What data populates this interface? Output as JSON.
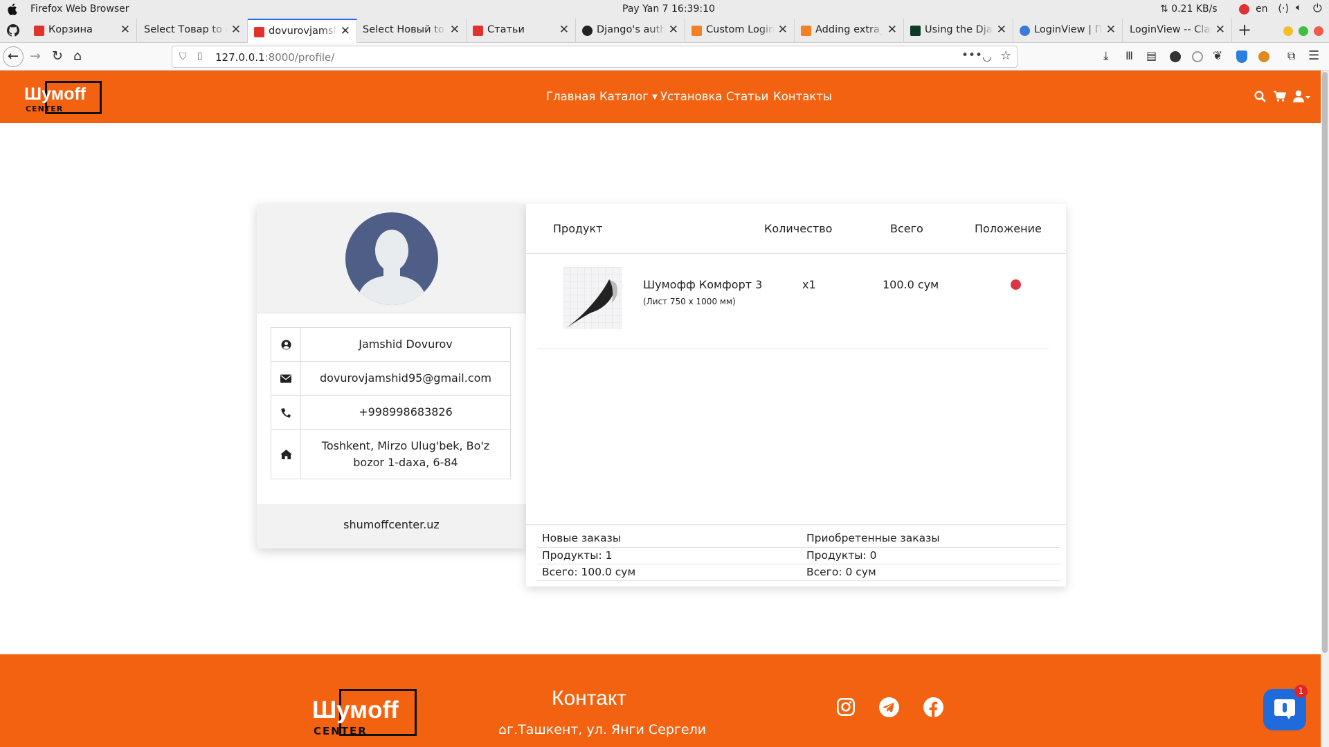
{
  "system": {
    "app_name": "Firefox Web Browser",
    "datetime": "Pay Yan 7  16:39:10",
    "net_speed": "⇅ 0.21 KB/s",
    "lang": "en"
  },
  "tabs": [
    {
      "label": "Корзина",
      "icon": "shumoff-favicon"
    },
    {
      "label": "Select Товар to ch",
      "icon": "none"
    },
    {
      "label": "dovurovjamshi",
      "icon": "shumoff-favicon",
      "active": true
    },
    {
      "label": "Select Новый to c",
      "icon": "none"
    },
    {
      "label": "Статьи",
      "icon": "shumoff-favicon"
    },
    {
      "label": "Django's auth",
      "icon": "github-icon"
    },
    {
      "label": "Custom LoginV",
      "icon": "stackoverflow-icon"
    },
    {
      "label": "Adding extra_c",
      "icon": "stackoverflow-icon"
    },
    {
      "label": "Using the Djan",
      "icon": "django-icon"
    },
    {
      "label": "LoginView | Пр",
      "icon": "djangoproject-icon"
    },
    {
      "label": "LoginView -- Class",
      "icon": "none"
    }
  ],
  "address_bar": {
    "host": "127.0.0.1",
    "port_path": ":8000/profile/"
  },
  "site": {
    "logo_main": "Шумoff",
    "logo_sub": "CENTER",
    "menu": {
      "home": "Главная",
      "catalog": "Каталог",
      "install": "Установка",
      "articles": "Статьи",
      "contacts": "Контакты"
    }
  },
  "profile": {
    "name": "Jamshid Dovurov",
    "email": "dovurovjamshid95@gmail.com",
    "phone": "+998998683826",
    "address": "Toshkent, Mirzo Ulug'bek, Bo'z bozor 1-daxa, 6-84",
    "footer": "shumoffcenter.uz"
  },
  "orders": {
    "headers": {
      "product": "Продукт",
      "qty": "Количество",
      "total": "Всего",
      "status": "Положение"
    },
    "items": [
      {
        "name": "Шумофф Комфорт 3",
        "variant": "(Лист 750 x 1000 мм)",
        "qty": "x1",
        "total": "100.0 сум",
        "status_color": "#dc3545"
      }
    ],
    "summary": {
      "new_title": "Новые заказы",
      "new_products": "Продукты: 1",
      "new_total": "Всего: 100.0 сум",
      "bought_title": "Приобретенные заказы",
      "bought_products": "Продукты: 0",
      "bought_total": "Всего: 0 сум"
    }
  },
  "footer": {
    "logo_main": "Шумoff",
    "logo_sub": "CENTER",
    "contact_title": "Контакт",
    "address": "г.Ташкент, ул. Янги Сергели"
  },
  "chat_badge": "1",
  "colors": {
    "brand": "#f26210",
    "status_red": "#dc3545",
    "avatar": "#4f5e86"
  }
}
